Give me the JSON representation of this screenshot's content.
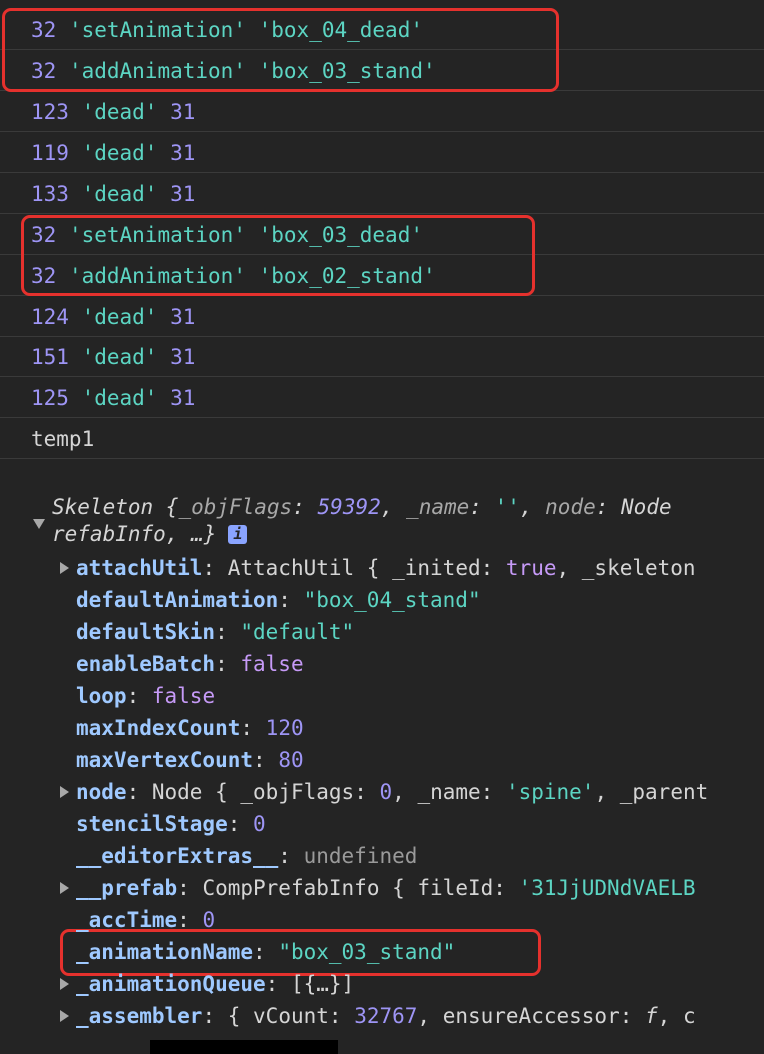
{
  "log_rows": [
    {
      "num": "32",
      "args": [
        "'setAnimation'",
        "'box_04_dead'"
      ]
    },
    {
      "num": "32",
      "args": [
        "'addAnimation'",
        "'box_03_stand'"
      ]
    },
    {
      "num": "123",
      "args": [
        "'dead'"
      ],
      "tail": "31"
    },
    {
      "num": "119",
      "args": [
        "'dead'"
      ],
      "tail": "31"
    },
    {
      "num": "133",
      "args": [
        "'dead'"
      ],
      "tail": "31"
    },
    {
      "num": "32",
      "args": [
        "'setAnimation'",
        "'box_03_dead'"
      ]
    },
    {
      "num": "32",
      "args": [
        "'addAnimation'",
        "'box_02_stand'"
      ]
    },
    {
      "num": "124",
      "args": [
        "'dead'"
      ],
      "tail": "31"
    },
    {
      "num": "151",
      "args": [
        "'dead'"
      ],
      "tail": "31"
    },
    {
      "num": "125",
      "args": [
        "'dead'"
      ],
      "tail": "31"
    }
  ],
  "input_echo": "temp1",
  "object": {
    "header_line1": {
      "class_name": "Skeleton {",
      "k1": "_objFlags",
      "v1": "59392",
      "k2": "_name",
      "v2": "''",
      "k3": "node",
      "v3": "Node"
    },
    "header_line2": "refabInfo, …}",
    "info_icon": "i",
    "props": [
      {
        "key": "attachUtil",
        "value": "AttachUtil {",
        "extra_k": "_inited",
        "extra_v": "true",
        "extra_tail": ", _skeleton"
      },
      {
        "key": "defaultAnimation",
        "value": "\"box_04_stand\""
      },
      {
        "key": "defaultSkin",
        "value": "\"default\""
      },
      {
        "key": "enableBatch",
        "value": "false"
      },
      {
        "key": "loop",
        "value": "false"
      },
      {
        "key": "maxIndexCount",
        "value": "120"
      },
      {
        "key": "maxVertexCount",
        "value": "80"
      },
      {
        "key": "node",
        "value": "Node {",
        "extra_k": "_objFlags",
        "extra_v": "0",
        "extra_k2": "_name",
        "extra_v2": "'spine'",
        "extra_tail": ", _parent"
      },
      {
        "key": "stencilStage",
        "value": "0"
      },
      {
        "key": "__editorExtras__",
        "value": "undefined"
      },
      {
        "key": "__prefab",
        "value": "CompPrefabInfo {",
        "extra_k": "fileId",
        "extra_v": "'31JjUDNdVAELB"
      },
      {
        "key": "_accTime",
        "value": "0"
      },
      {
        "key": "_animationName",
        "value": "\"box_03_stand\""
      },
      {
        "key": "_animationQueue",
        "value": "[{…}]"
      },
      {
        "key": "_assembler",
        "value": "{",
        "extra_k": "vCount",
        "extra_v": "32767",
        "extra_k2": "ensureAccessor",
        "extra_v2": "f",
        "extra_tail": ", c"
      }
    ]
  },
  "colors": {
    "background": "#242424",
    "highlight": "#e5312d",
    "number": "#9e95f5",
    "string": "#5cd5c3",
    "key": "#9fc9ff"
  }
}
